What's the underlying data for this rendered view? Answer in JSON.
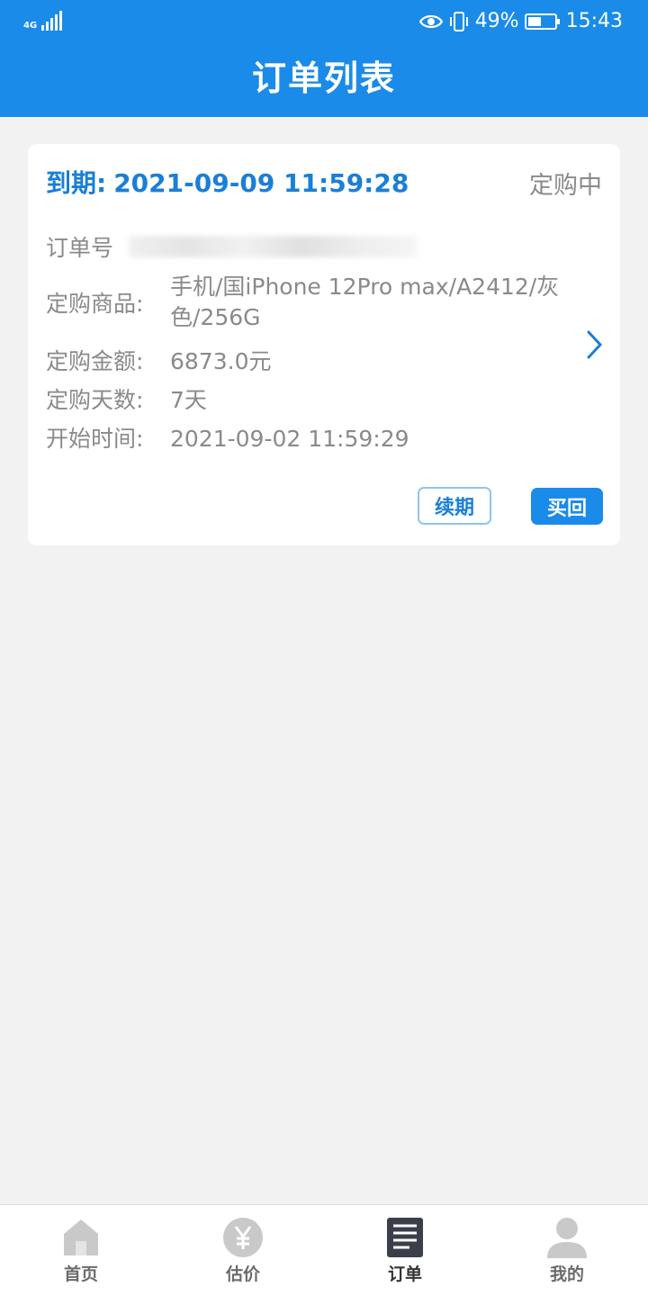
{
  "status_bar": {
    "network": "4G",
    "battery_percent": "49%",
    "time": "15:43",
    "icons": [
      "signal-icon",
      "eye-icon",
      "vibrate-icon",
      "battery-icon"
    ]
  },
  "header": {
    "title": "订单列表"
  },
  "order": {
    "due_label": "到期:",
    "due_time": "2021-09-09 11:59:28",
    "state": "定购中",
    "order_no_label": "订单号",
    "goods_label": "定购商品:",
    "goods_value": "手机/国iPhone 12Pro max/A2412/灰色/256G",
    "amount_label": "定购金额:",
    "amount_value": "6873.0元",
    "days_label": "定购天数:",
    "days_value": "7天",
    "start_label": "开始时间:",
    "start_value": "2021-09-02 11:59:29",
    "renew_button": "续期",
    "buyback_button": "买回"
  },
  "tabbar": {
    "active": 2,
    "items": [
      {
        "label": "首页",
        "icon": "home-icon"
      },
      {
        "label": "估价",
        "icon": "yen-icon"
      },
      {
        "label": "订单",
        "icon": "order-list-icon"
      },
      {
        "label": "我的",
        "icon": "user-icon"
      }
    ]
  },
  "colors": {
    "primary": "#1a8be8",
    "due_text": "#1a7fd6",
    "muted_text": "#8a8a8a",
    "background": "#f2f2f2"
  }
}
